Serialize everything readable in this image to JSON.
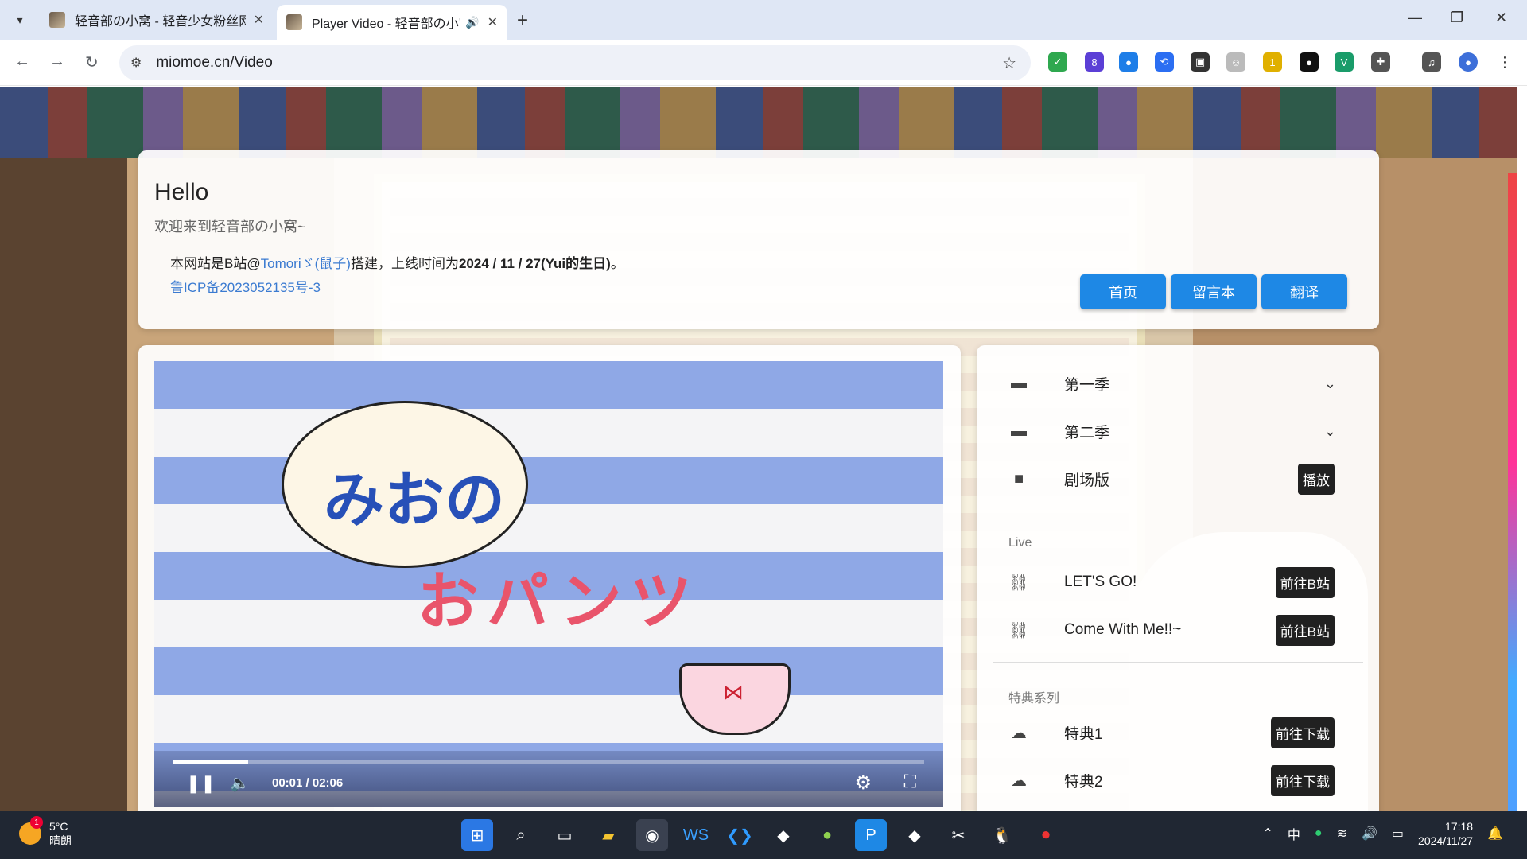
{
  "browser": {
    "tabs": [
      {
        "title": "轻音部の小窝 - 轻音少女粉丝网",
        "active": false
      },
      {
        "title": "Player Video - 轻音部の小窝",
        "active": true
      }
    ],
    "url": "miomoe.cn/Video",
    "extension_badges": {
      "e2": "8",
      "e8": "1"
    }
  },
  "header": {
    "title": "Hello",
    "subtitle": "欢迎来到轻音部の小窝~",
    "intro_prefix": "本网站是B站@",
    "author": "Tomoriゞ(鼠子)",
    "intro_mid": "搭建，上线时间为",
    "date": "2024 / 11 / 27(Yui的生日)",
    "intro_end": "。",
    "icp": "鲁ICP备2023052135号-3",
    "nav": {
      "home": "首页",
      "guestbook": "留言本",
      "translate": "翻译"
    }
  },
  "player": {
    "current_time": "00:01",
    "duration": "02:06",
    "time_display": "00:01 / 02:06",
    "progress": 0.1,
    "bubble_text": "みおの",
    "title_text": "おパンツ"
  },
  "playlist": {
    "seasons": [
      {
        "label": "第一季",
        "icon": "folder-icon"
      },
      {
        "label": "第二季",
        "icon": "folder-icon"
      },
      {
        "label": "剧场版",
        "icon": "video-camera-icon",
        "action": "播放"
      }
    ],
    "live_header": "Live",
    "live": [
      {
        "label": "LET'S GO!",
        "action": "前往B站"
      },
      {
        "label": "Come With Me!!~",
        "action": "前往B站"
      }
    ],
    "extras_header": "特典系列",
    "extras": [
      {
        "label": "特典1",
        "action": "前往下载"
      },
      {
        "label": "特典2",
        "action": "前往下载"
      }
    ]
  },
  "taskbar": {
    "temperature": "5°C",
    "weather": "晴朗",
    "weather_badge": "1",
    "ime": "中",
    "time": "17:18",
    "date": "2024/11/27"
  }
}
